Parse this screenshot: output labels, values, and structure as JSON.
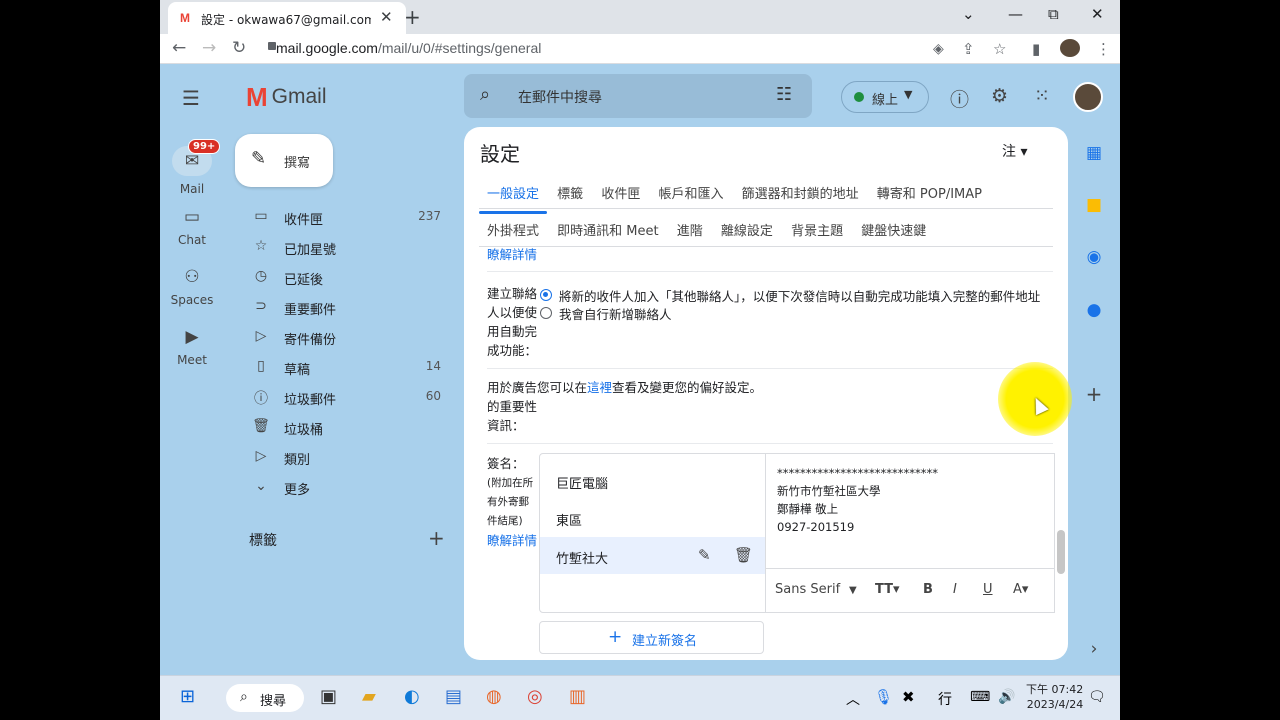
{
  "browser": {
    "tab_title": "設定 - okwawa67@gmail.com",
    "tab_close": "✕",
    "new_tab": "+",
    "url_host": "mail.google.com",
    "url_path": "/mail/u/0/#settings/general",
    "win_minimize": "⌄",
    "win_min2": "—",
    "win_max": "⧉",
    "win_close": "✕"
  },
  "gmail": {
    "logo_word": "Gmail",
    "search_placeholder": "在郵件中搜尋",
    "status_label": "線上",
    "rail": {
      "mail": "Mail",
      "mail_badge": "99+",
      "chat": "Chat",
      "spaces": "Spaces",
      "meet": "Meet"
    },
    "compose_label": "撰寫",
    "nav": [
      {
        "label": "收件匣",
        "count": "237",
        "icon": "inbox-icon",
        "glyph": "▭"
      },
      {
        "label": "已加星號",
        "count": "",
        "icon": "star-icon",
        "glyph": "☆"
      },
      {
        "label": "已延後",
        "count": "",
        "icon": "clock-icon",
        "glyph": "◷"
      },
      {
        "label": "重要郵件",
        "count": "",
        "icon": "important-icon",
        "glyph": "⊃"
      },
      {
        "label": "寄件備份",
        "count": "",
        "icon": "send-icon",
        "glyph": "▷"
      },
      {
        "label": "草稿",
        "count": "14",
        "icon": "draft-icon",
        "glyph": "▯"
      },
      {
        "label": "垃圾郵件",
        "count": "60",
        "icon": "spam-icon",
        "glyph": "ⓘ"
      },
      {
        "label": "垃圾桶",
        "count": "",
        "icon": "trash-icon",
        "glyph": "🗑"
      },
      {
        "label": "類別",
        "count": "",
        "icon": "label-icon",
        "glyph": "▷"
      },
      {
        "label": "更多",
        "count": "",
        "icon": "chevron-down-icon",
        "glyph": "⌄"
      }
    ],
    "labels_heading": "標籤"
  },
  "settings": {
    "title": "設定",
    "input_tools": "注 ▾",
    "tabs_row1": [
      "一般設定",
      "標籤",
      "收件匣",
      "帳戶和匯入",
      "篩選器和封鎖的地址",
      "轉寄和 POP/IMAP"
    ],
    "tabs_row2": [
      "外掛程式",
      "即時通訊和 Meet",
      "進階",
      "離線設定",
      "背景主題",
      "鍵盤快速鍵"
    ],
    "learn_more": "瞭解詳情",
    "create_contacts": {
      "label": [
        "建立聯絡",
        "人以便使",
        "用自動完",
        "成功能："
      ],
      "options": [
        "將新的收件人加入「其他聯絡人」，以便下次發信時以自動完成功能填入完整的郵件地址",
        "我會自行新增聯絡人"
      ]
    },
    "ads": {
      "label": [
        "用於廣告",
        "的重要性",
        "資訊："
      ],
      "text_pre": "您可以在",
      "link": "這裡",
      "text_post": "查看及變更您的偏好設定。"
    },
    "signature": {
      "label": "簽名：",
      "sub": [
        "(附加在所",
        "有外寄郵",
        "件結尾)"
      ],
      "learn_more": "瞭解詳情",
      "items": [
        "巨匠電腦",
        "東區",
        "竹塹社大"
      ],
      "body": [
        "****************************",
        "新竹市竹塹社區大學",
        "鄭靜樺  敬上",
        "0927-201519"
      ],
      "font": "Sans Serif",
      "new_label": "建立新簽名"
    }
  },
  "taskbar": {
    "search": "搜尋",
    "ime": "行",
    "time": "下午 07:42",
    "date": "2023/4/24"
  }
}
